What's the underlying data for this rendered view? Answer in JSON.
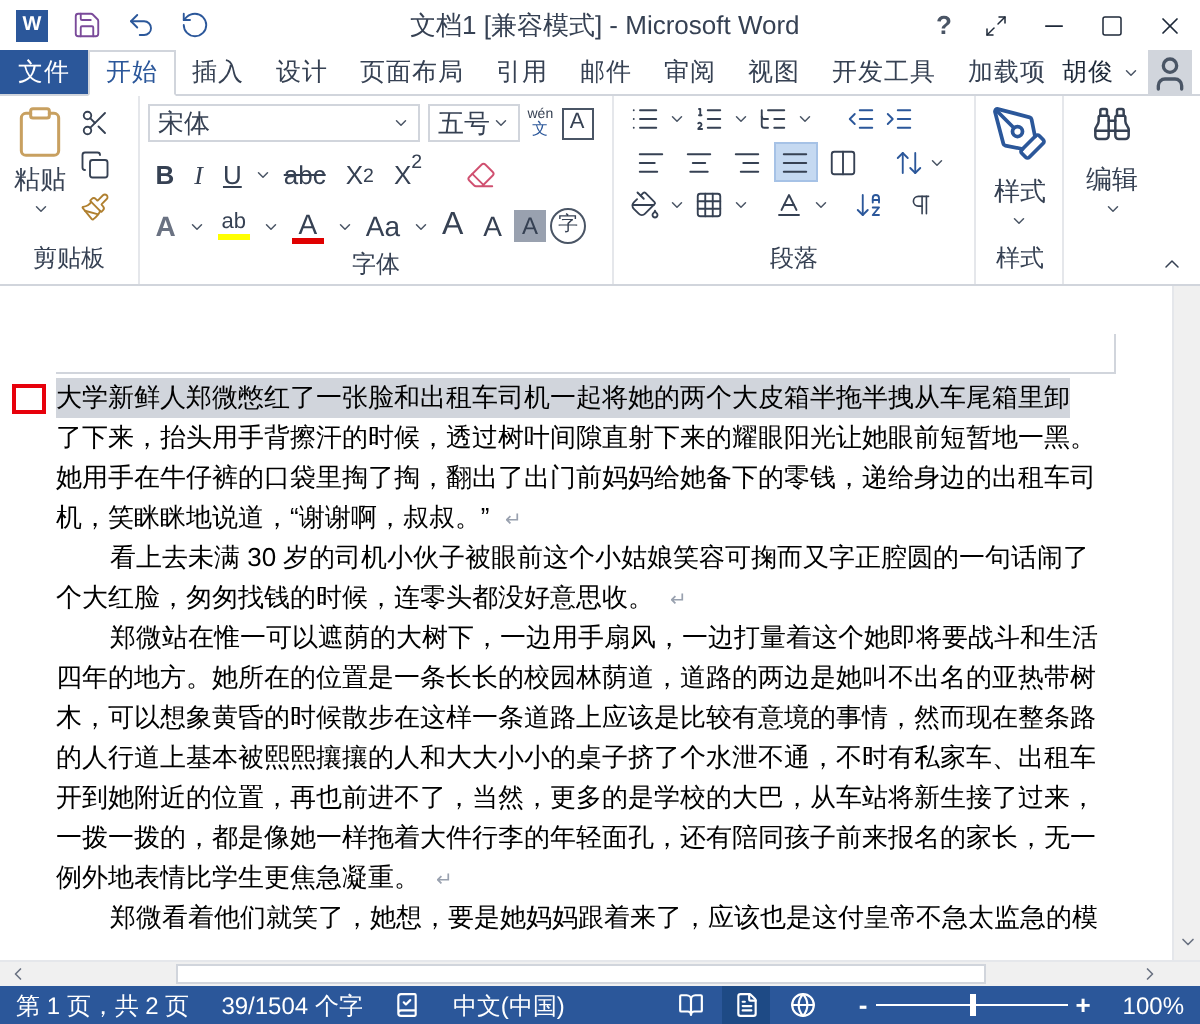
{
  "window": {
    "app_letter": "W",
    "title": "文档1 [兼容模式] - Microsoft Word",
    "help": "?"
  },
  "tabs": [
    {
      "label": "文件",
      "kind": "file",
      "selected": false
    },
    {
      "label": "开始",
      "kind": "tab",
      "selected": true
    },
    {
      "label": "插入",
      "kind": "tab",
      "selected": false
    },
    {
      "label": "设计",
      "kind": "tab",
      "selected": false
    },
    {
      "label": "页面布局",
      "kind": "tab",
      "selected": false
    },
    {
      "label": "引用",
      "kind": "tab",
      "selected": false
    },
    {
      "label": "邮件",
      "kind": "tab",
      "selected": false
    },
    {
      "label": "审阅",
      "kind": "tab",
      "selected": false
    },
    {
      "label": "视图",
      "kind": "tab",
      "selected": false
    },
    {
      "label": "开发工具",
      "kind": "tab",
      "selected": false
    },
    {
      "label": "加载项",
      "kind": "tab",
      "selected": false
    }
  ],
  "user": {
    "name": "胡俊"
  },
  "ribbon": {
    "clipboard": {
      "label": "剪贴板",
      "paste": "粘贴"
    },
    "font": {
      "label": "字体",
      "font_name": "宋体",
      "font_size": "五号",
      "phonetic_top": "wén",
      "phonetic_bottom": "文",
      "border_char": "A",
      "format_buttons": [
        {
          "label": "B",
          "kind": "bold"
        },
        {
          "label": "I",
          "kind": "italic"
        },
        {
          "label": "U",
          "kind": "underline"
        },
        {
          "label": "abc",
          "kind": "strike"
        },
        {
          "label": "X$_{2}$",
          "kind": "plain"
        },
        {
          "label": "X$^{2}$",
          "kind": "plain"
        }
      ],
      "effects": [
        {
          "label": "A",
          "kind": "outline"
        },
        {
          "label": "ab",
          "kind": "highlight",
          "color": "#ffff00"
        },
        {
          "label": "A",
          "kind": "fontcolor",
          "color": "#e00000"
        },
        {
          "label": "Aa",
          "kind": "case"
        },
        {
          "label": "A",
          "kind": "grow"
        },
        {
          "label": "A",
          "kind": "shrink"
        },
        {
          "label": "A",
          "kind": "shade"
        },
        {
          "label": "字",
          "kind": "circle"
        }
      ]
    },
    "paragraph": {
      "label": "段落",
      "align": [
        {
          "kind": "left",
          "selected": false
        },
        {
          "kind": "center",
          "selected": false
        },
        {
          "kind": "right",
          "selected": false
        },
        {
          "kind": "justify",
          "selected": true
        },
        {
          "kind": "distribute",
          "selected": false
        }
      ]
    },
    "styles": {
      "label": "样式",
      "button": "样式"
    },
    "editing": {
      "button": "编辑"
    }
  },
  "document": {
    "paragraphs": [
      {
        "first_line_indent": false,
        "end_mark": "↵",
        "lines": [
          {
            "text": "大学新鲜人郑微憋红了一张脸和出租车司机一起将她的两个大皮箱半拖半拽从车尾箱里卸",
            "selected": true
          },
          {
            "text": "了下来，抬头用手背擦汗的时候，透过树叶间隙直射下来的耀眼阳光让她眼前短暂地一黑。",
            "selected": false
          },
          {
            "text": "她用手在牛仔裤的口袋里掏了掏，翻出了出门前妈妈给她备下的零钱，递给身边的出租车司",
            "selected": false
          },
          {
            "text": "机，笑眯眯地说道，“谢谢啊，叔叔。”",
            "selected": false
          }
        ]
      },
      {
        "first_line_indent": true,
        "end_mark": "↵",
        "lines": [
          {
            "text": "看上去未满 30 岁的司机小伙子被眼前这个小姑娘笑容可掬而又字正腔圆的一句话闹了",
            "selected": false
          },
          {
            "text": "个大红脸，匆匆找钱的时候，连零头都没好意思收。",
            "selected": false
          }
        ]
      },
      {
        "first_line_indent": true,
        "end_mark": "↵",
        "lines": [
          {
            "text": "郑微站在惟一可以遮荫的大树下，一边用手扇风，一边打量着这个她即将要战斗和生活",
            "selected": false
          },
          {
            "text": "四年的地方。她所在的位置是一条长长的校园林荫道，道路的两边是她叫不出名的亚热带树",
            "selected": false
          },
          {
            "text": "木，可以想象黄昏的时候散步在这样一条道路上应该是比较有意境的事情，然而现在整条路",
            "selected": false
          },
          {
            "text": "的人行道上基本被熙熙攘攘的人和大大小小的桌子挤了个水泄不通，不时有私家车、出租车",
            "selected": false
          },
          {
            "text": "开到她附近的位置，再也前进不了，当然，更多的是学校的大巴，从车站将新生接了过来，",
            "selected": false
          },
          {
            "text": "一拨一拨的，都是像她一样拖着大件行李的年轻面孔，还有陪同孩子前来报名的家长，无一",
            "selected": false
          },
          {
            "text": "例外地表情比学生更焦急凝重。",
            "selected": false
          }
        ]
      },
      {
        "first_line_indent": true,
        "lines": [
          {
            "text": "郑微看着他们就笑了，她想，要是她妈妈跟着来了，应该也是这付皇帝不急太监急的模",
            "selected": false
          }
        ]
      }
    ]
  },
  "status_bar": {
    "page": "第 1 页，共 2 页",
    "words": "39/1504 个字",
    "language": "中文(中国)",
    "views": [
      {
        "kind": "read",
        "selected": false
      },
      {
        "kind": "print",
        "selected": true
      },
      {
        "kind": "web",
        "selected": false
      }
    ],
    "zoom_minus": "-",
    "zoom_plus": "+",
    "zoom": {
      "level": 0.5
    },
    "zoom_reading": "100%"
  }
}
